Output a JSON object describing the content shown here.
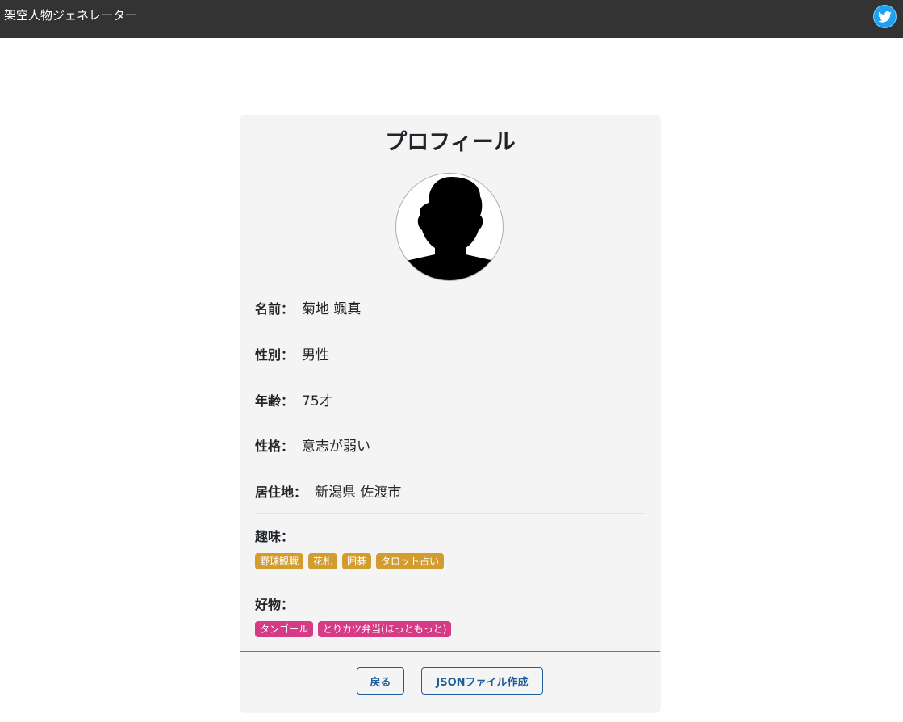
{
  "navbar": {
    "brand": "架空人物ジェネレーター",
    "twitter_icon": "twitter-bird-icon"
  },
  "profile": {
    "title": "プロフィール",
    "avatar_icon": "person-silhouette-icon",
    "name_label": "名前：",
    "name_value": "菊地 颯真",
    "gender_label": "性別：",
    "gender_value": "男性",
    "age_label": "年齢：",
    "age_value": "75才",
    "personality_label": "性格：",
    "personality_value": "意志が弱い",
    "residence_label": "居住地：",
    "residence_value": "新潟県 佐渡市",
    "hobbies_label": "趣味：",
    "hobbies": [
      "野球観戦",
      "花札",
      "囲碁",
      "タロット占い"
    ],
    "likes_label": "好物：",
    "likes": [
      "タンゴール",
      "とりカツ弁当(ほっともっと)"
    ]
  },
  "actions": {
    "back_label": "戻る",
    "json_label": "JSONファイル作成"
  },
  "colors": {
    "navbar_bg": "#333333",
    "hobby_tag": "#d29d2e",
    "like_tag": "#d63b86",
    "button_accent": "#1f5d99"
  }
}
